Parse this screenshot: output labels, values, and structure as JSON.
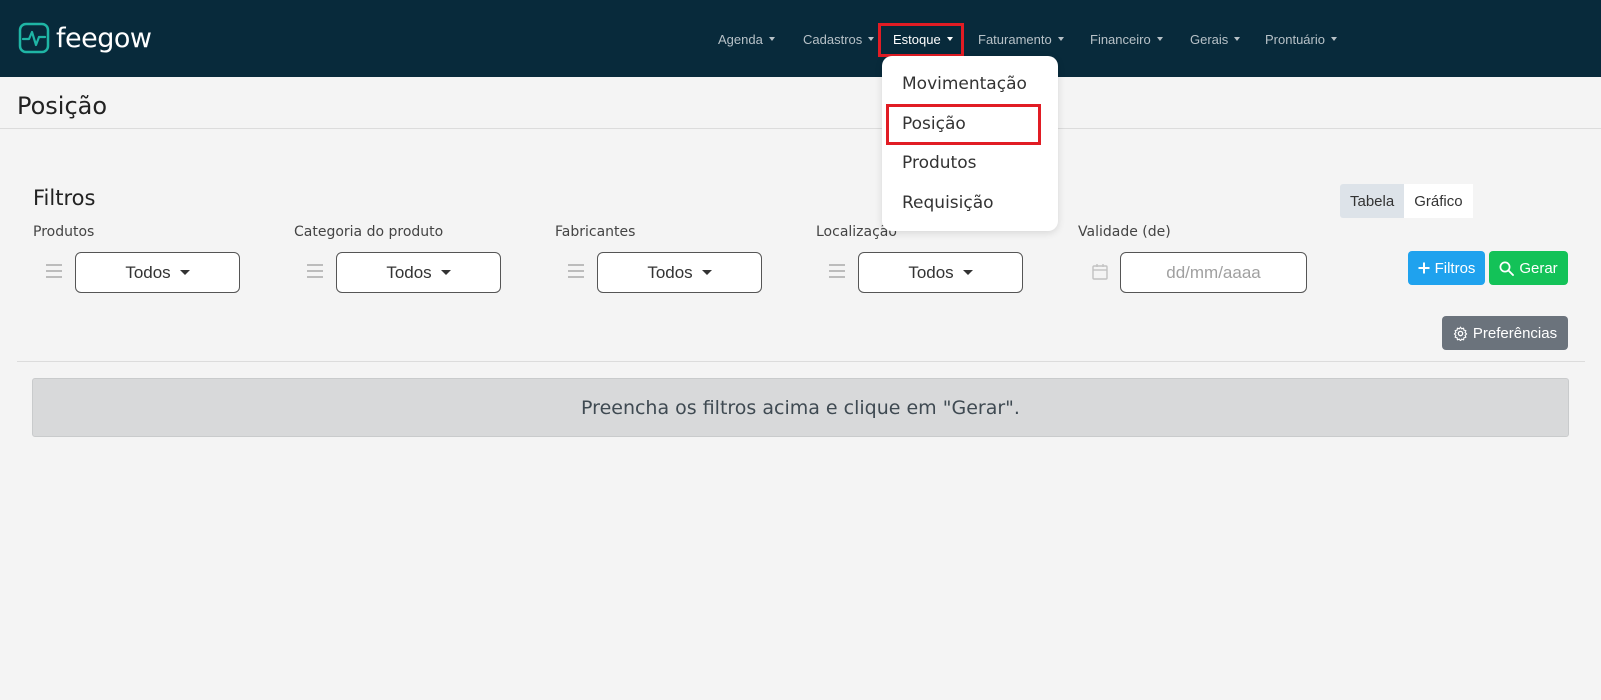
{
  "brand": {
    "name": "feegow",
    "mark_color": "#1fb5a5"
  },
  "nav": {
    "items": [
      {
        "label": "Agenda"
      },
      {
        "label": "Cadastros"
      },
      {
        "label": "Estoque"
      },
      {
        "label": "Faturamento"
      },
      {
        "label": "Financeiro"
      },
      {
        "label": "Gerais"
      },
      {
        "label": "Prontuário"
      }
    ],
    "active": "Estoque"
  },
  "dropdown": {
    "items": [
      {
        "label": "Movimentação"
      },
      {
        "label": "Posição"
      },
      {
        "label": "Produtos"
      },
      {
        "label": "Requisição"
      }
    ],
    "highlighted": "Posição"
  },
  "page": {
    "title": "Posição"
  },
  "filters": {
    "title": "Filtros",
    "view_toggle": {
      "table": "Tabela",
      "chart": "Gráfico",
      "selected": "Tabela"
    },
    "fields": [
      {
        "label": "Produtos",
        "value": "Todos"
      },
      {
        "label": "Categoria do produto",
        "value": "Todos"
      },
      {
        "label": "Fabricantes",
        "value": "Todos"
      },
      {
        "label": "Localização",
        "value": "Todos"
      }
    ],
    "date": {
      "label": "Validade (de)",
      "placeholder": "dd/mm/aaaa"
    },
    "buttons": {
      "more_filters": "Filtros",
      "generate": "Gerar",
      "preferences": "Preferências"
    }
  },
  "alert": {
    "message": "Preencha os filtros acima e clique em \"Gerar\"."
  },
  "colors": {
    "navbar": "#082a3b",
    "highlight": "#e11c24",
    "filters_button": "#1fa2ee",
    "generate_button": "#13c258",
    "preferences_button": "#6b737c"
  }
}
